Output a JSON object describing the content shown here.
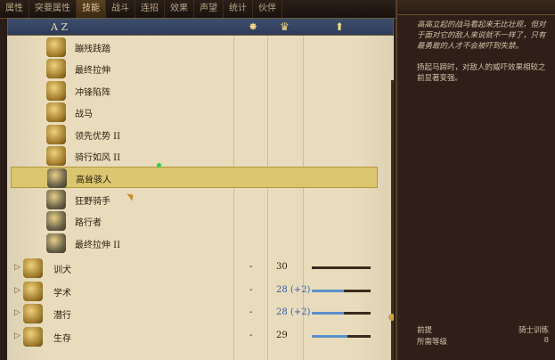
{
  "tabs": [
    {
      "label": "属性",
      "active": false
    },
    {
      "label": "突要属性",
      "active": false
    },
    {
      "label": "技能",
      "active": true
    },
    {
      "label": "战斗",
      "active": false
    },
    {
      "label": "连招",
      "active": false
    },
    {
      "label": "效果",
      "active": false
    },
    {
      "label": "声望",
      "active": false
    },
    {
      "label": "统计",
      "active": false
    },
    {
      "label": "伙伴",
      "active": false
    }
  ],
  "columns": {
    "sort_label": "A Z",
    "icons": [
      "sun-icon",
      "crown-icon",
      "arrow-up-icon"
    ]
  },
  "perks": [
    {
      "label": "蹦残践踏",
      "selected": false,
      "icon": "horse-trample-icon"
    },
    {
      "label": "最终拉伸",
      "selected": false,
      "icon": "horse-rear-icon"
    },
    {
      "label": "冲锋陷阵",
      "selected": false,
      "icon": "charge-icon"
    },
    {
      "label": "战马",
      "selected": false,
      "icon": "warhorse-icon"
    },
    {
      "label": "领先优势 II",
      "selected": false,
      "icon": "lead-icon"
    },
    {
      "label": "骑行如风 II",
      "selected": false,
      "icon": "ride-wind-icon"
    },
    {
      "label": "高耸骇人",
      "selected": true,
      "icon": "towering-icon"
    },
    {
      "label": "狂野骑手",
      "selected": false,
      "icon": "wild-rider-icon"
    },
    {
      "label": "路行者",
      "selected": false,
      "icon": "wayfarer-icon"
    },
    {
      "label": "最终拉伸 II",
      "selected": false,
      "icon": "horse-rear-2-icon"
    }
  ],
  "skills": [
    {
      "label": "训犬",
      "dash": "-",
      "value": "30",
      "blue": false,
      "progress": 0.0
    },
    {
      "label": "学术",
      "dash": "-",
      "value": "28 (+2)",
      "blue": true,
      "progress": 0.55
    },
    {
      "label": "潜行",
      "dash": "-",
      "value": "28 (+2)",
      "blue": true,
      "progress": 0.55
    },
    {
      "label": "生存",
      "dash": "-",
      "value": "29",
      "blue": false,
      "progress": 0.6
    }
  ],
  "info": {
    "flavor": "高高立起的战马看起来无比壮观，但对于面对它的敌人来说就不一样了，只有最勇敢的人才不会被吓到失禁。",
    "effect": "扬起马蹄时，对敌人的威吓效果相较之前显著变强。",
    "requirement_label": "前提",
    "requirement_value": "骑士训练",
    "level_label": "所需等级",
    "level_value": "8"
  },
  "colors": {
    "accent": "#d9c66e",
    "panel": "#e8dcbc",
    "dark": "#2e2019",
    "blue": "#3d5ea8"
  }
}
